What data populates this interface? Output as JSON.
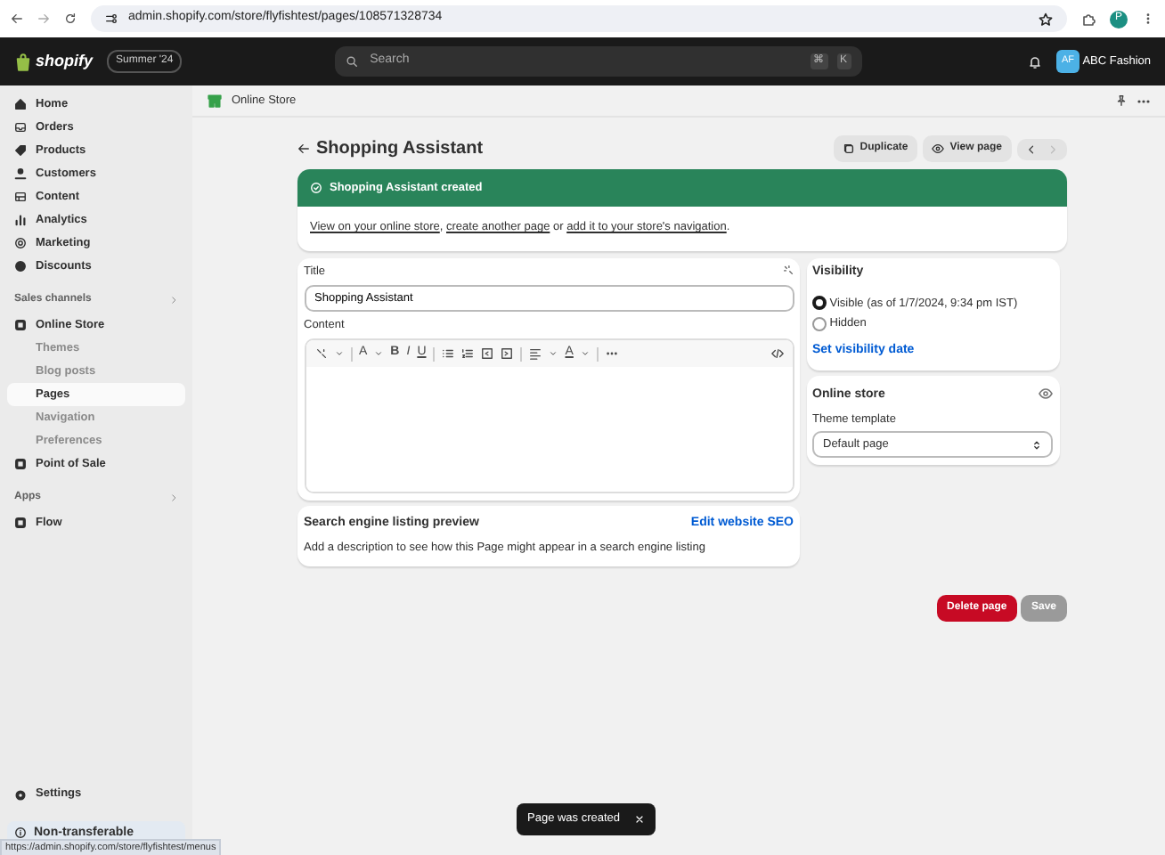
{
  "browser": {
    "url": "admin.shopify.com/store/flyfishtest/pages/108571328734",
    "profile": "P"
  },
  "topbar": {
    "logo": "shopify",
    "edition": "Summer '24",
    "search_placeholder": "Search",
    "shortcut": [
      "⌘",
      "K"
    ],
    "store_initials": "AF",
    "store_name": "ABC Fashion"
  },
  "sidebar": {
    "items": [
      {
        "label": "Home"
      },
      {
        "label": "Orders"
      },
      {
        "label": "Products"
      },
      {
        "label": "Customers"
      },
      {
        "label": "Content"
      },
      {
        "label": "Analytics"
      },
      {
        "label": "Marketing"
      },
      {
        "label": "Discounts"
      }
    ],
    "sections": [
      {
        "title": "Sales channels",
        "items": [
          {
            "label": "Online Store",
            "children": [
              {
                "label": "Themes",
                "selected": false
              },
              {
                "label": "Blog posts",
                "selected": false
              },
              {
                "label": "Pages",
                "selected": true
              },
              {
                "label": "Navigation",
                "selected": false
              },
              {
                "label": "Preferences",
                "selected": false
              }
            ]
          },
          {
            "label": "Point of Sale"
          }
        ]
      },
      {
        "title": "Apps",
        "items": [
          {
            "label": "Flow"
          }
        ]
      }
    ],
    "settings": "Settings",
    "notice": "Non-transferable"
  },
  "subheader": {
    "title": "Online Store"
  },
  "page": {
    "title": "Shopping Assistant",
    "actions": [
      "Duplicate",
      "View page"
    ]
  },
  "banner": {
    "title": "Shopping Assistant created",
    "message": [
      {
        "kind": "link",
        "text": "View on your online store"
      },
      {
        "kind": "text",
        "text": ", "
      },
      {
        "kind": "link",
        "text": "create another page"
      },
      {
        "kind": "text",
        "text": " or "
      },
      {
        "kind": "link",
        "text": "add it to your store's navigation"
      },
      {
        "kind": "text",
        "text": "."
      }
    ]
  },
  "editor": {
    "title_label": "Title",
    "title_value": "Shopping Assistant",
    "content_label": "Content",
    "toolbar": [
      {
        "kind": "magic"
      },
      {
        "kind": "caret"
      },
      {
        "kind": "sep"
      },
      {
        "kind": "letter",
        "text": "A"
      },
      {
        "kind": "caret"
      },
      {
        "kind": "bold",
        "text": "B"
      },
      {
        "kind": "italic",
        "text": "I"
      },
      {
        "kind": "underline",
        "text": "U"
      },
      {
        "kind": "sep"
      },
      {
        "kind": "bullets"
      },
      {
        "kind": "numbers"
      },
      {
        "kind": "outdent"
      },
      {
        "kind": "indent"
      },
      {
        "kind": "sep"
      },
      {
        "kind": "align"
      },
      {
        "kind": "caret"
      },
      {
        "kind": "underline",
        "text": "A"
      },
      {
        "kind": "caret"
      },
      {
        "kind": "sep"
      },
      {
        "kind": "more"
      },
      {
        "kind": "spacer"
      },
      {
        "kind": "code"
      }
    ]
  },
  "seo": {
    "title": "Search engine listing preview",
    "link": "Edit website SEO",
    "description": "Add a description to see how this Page might appear in a search engine listing"
  },
  "visibility": {
    "title": "Visibility",
    "options": [
      {
        "label": "Visible (as of 1/7/2024, 9:34 pm IST)",
        "selected": true
      },
      {
        "label": "Hidden",
        "selected": false
      }
    ],
    "link": "Set visibility date"
  },
  "online_store": {
    "title": "Online store",
    "template_label": "Theme template",
    "template_value": "Default page"
  },
  "footer_buttons": [
    {
      "label": "Delete page",
      "kind": "danger",
      "disabled": false
    },
    {
      "label": "Save",
      "kind": "primary",
      "disabled": true
    }
  ],
  "toast": {
    "message": "Page was created"
  },
  "status_url": "https://admin.shopify.com/store/flyfishtest/menus"
}
